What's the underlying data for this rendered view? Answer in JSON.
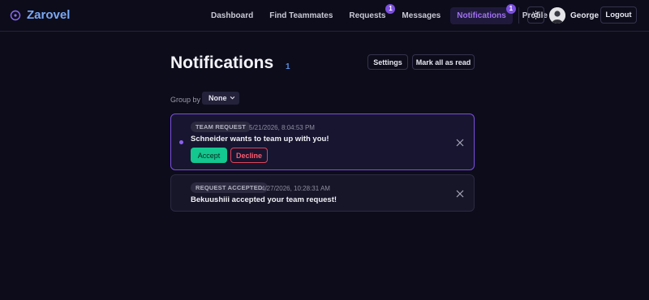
{
  "brand": {
    "name": "Zarovel",
    "accent": "#7aa9f5"
  },
  "nav": {
    "items": [
      {
        "label": "Dashboard",
        "active": false,
        "badge": ""
      },
      {
        "label": "Find Teammates",
        "active": false,
        "badge": ""
      },
      {
        "label": "Requests",
        "active": false,
        "badge": "1"
      },
      {
        "label": "Messages",
        "active": false,
        "badge": ""
      },
      {
        "label": "Notifications",
        "active": true,
        "badge": "1"
      },
      {
        "label": "Profile",
        "active": false,
        "badge": ""
      }
    ],
    "theme_icon": "sun-icon",
    "user": {
      "name": "George",
      "avatar_icon": "user-avatar"
    },
    "logout_label": "Logout"
  },
  "page": {
    "title": "Notifications",
    "count": "1",
    "settings_label": "Settings",
    "mark_all_label": "Mark all as read",
    "group_by_label": "Group by",
    "group_by_value": "None"
  },
  "notifications": [
    {
      "tag": "TEAM REQUEST",
      "timestamp": "5/21/2026, 8:04:53 PM",
      "message": "Schneider wants to team up with you!",
      "unread": true,
      "accept_label": "Accept",
      "decline_label": "Decline"
    },
    {
      "tag": "REQUEST ACCEPTED",
      "timestamp": "4/27/2026, 10:28:31 AM",
      "message": "Bekuushiii accepted your team request!",
      "unread": false
    }
  ],
  "colors": {
    "background": "#0d0c1a",
    "accent_purple": "#7c4fe0",
    "accept_green": "#13c78f",
    "decline_red": "#e0435a"
  }
}
